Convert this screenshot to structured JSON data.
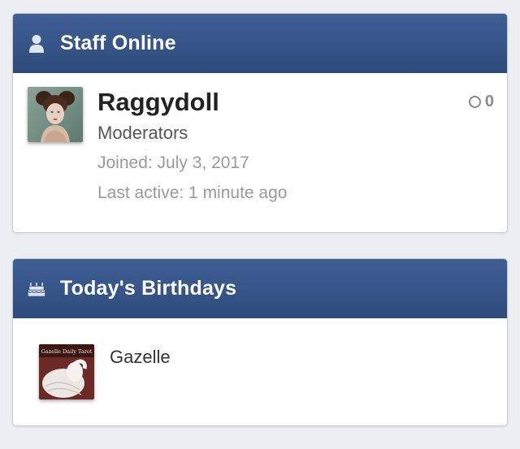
{
  "staff_widget": {
    "title": "Staff Online",
    "icon": "user-icon",
    "member": {
      "name": "Raggydoll",
      "group": "Moderators",
      "joined": "Joined: July 3, 2017",
      "last_active": "Last active: 1 minute ago",
      "reputation": "0",
      "avatar": "avatar-raggydoll"
    }
  },
  "birthday_widget": {
    "title": "Today's Birthdays",
    "icon": "birthday-cake-icon",
    "member": {
      "name": "Gazelle",
      "avatar_caption": "Gazelle Daily Tarot",
      "avatar": "avatar-gazelle"
    }
  },
  "colors": {
    "header_top": "#3e5f95",
    "header_bottom": "#2f4b7c",
    "page_bg": "#eceef1"
  }
}
